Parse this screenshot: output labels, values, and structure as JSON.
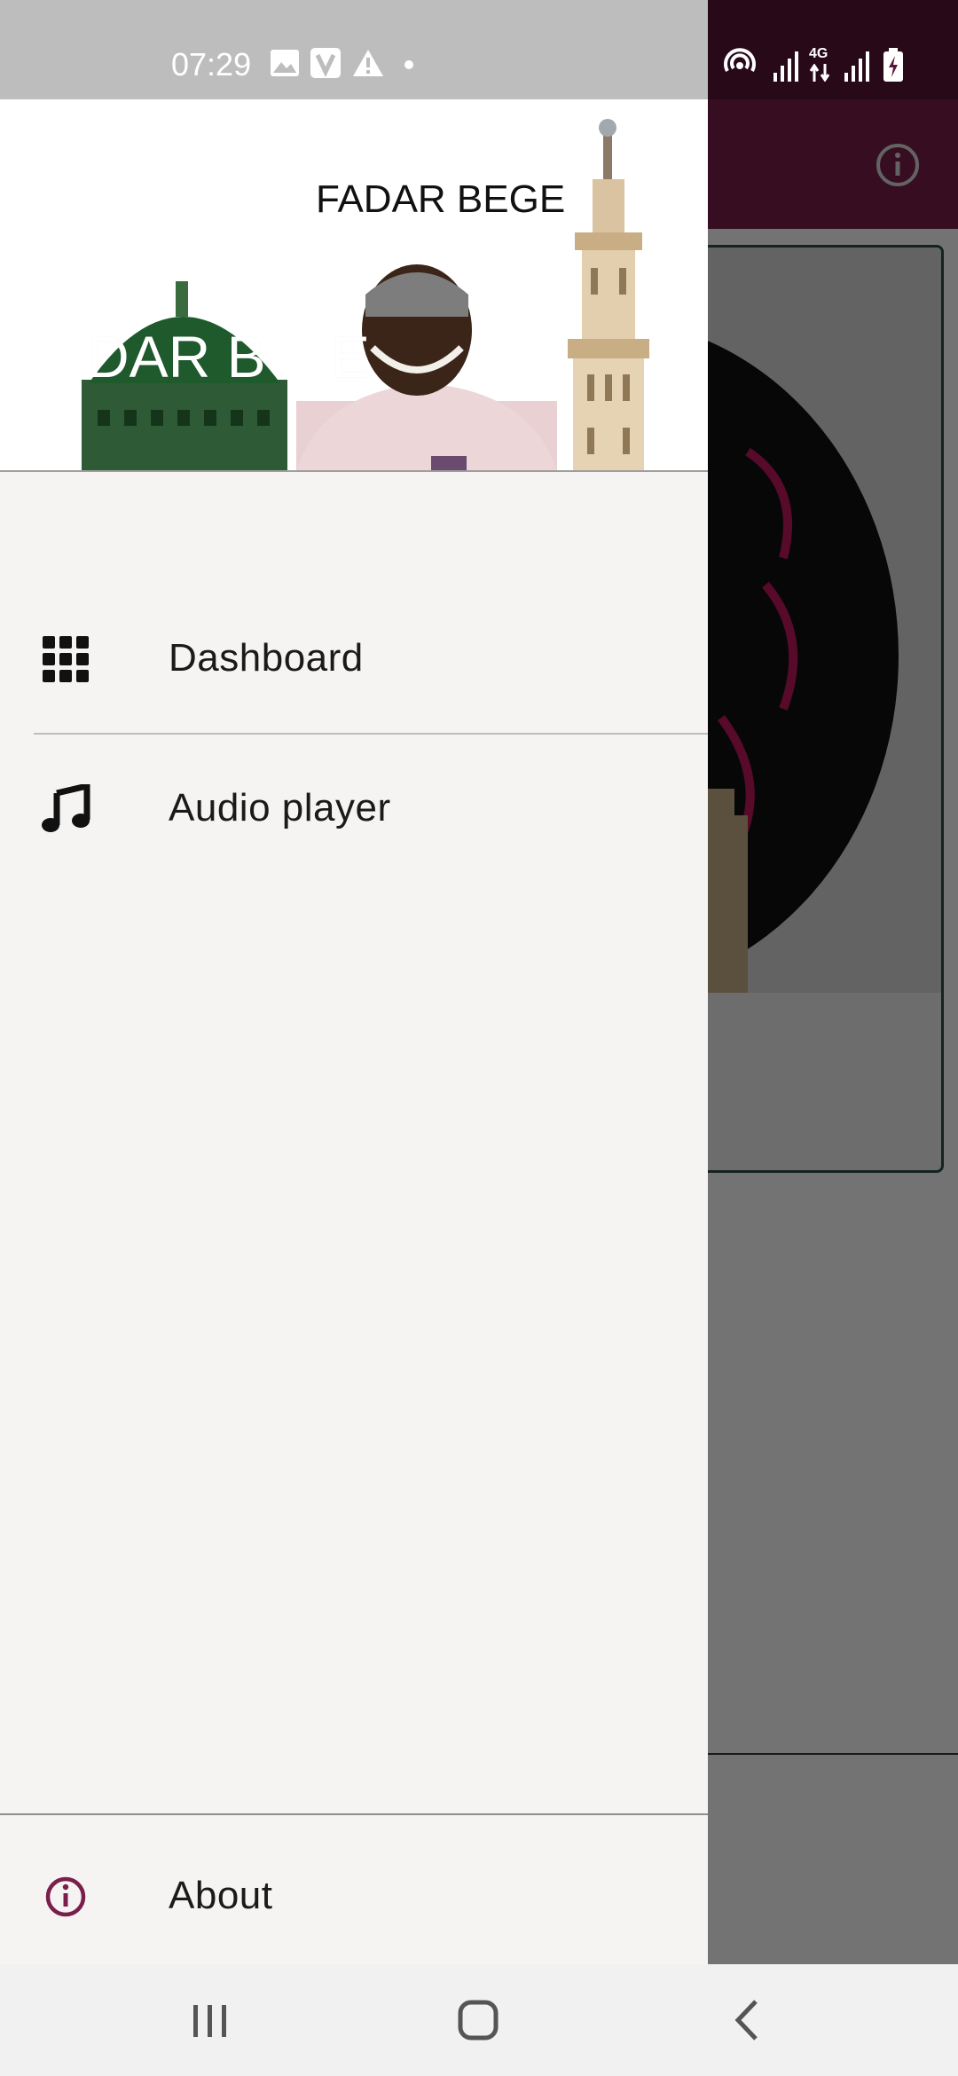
{
  "status_bar": {
    "time": "07:29",
    "network": "4G"
  },
  "drawer": {
    "header": {
      "title": "FADAR BEGE",
      "watermark": "DAR B    E"
    },
    "menu": [
      {
        "label": "Dashboard",
        "icon": "grid-icon"
      },
      {
        "label": "Audio player",
        "icon": "music-note-icon"
      }
    ],
    "footer": {
      "label": "About",
      "icon": "info-icon"
    }
  },
  "colors": {
    "primary": "#7a1e4b",
    "primary_dark": "#5a1636",
    "accent": "#7a1e4b",
    "drawer_bg": "#f5f4f2"
  }
}
